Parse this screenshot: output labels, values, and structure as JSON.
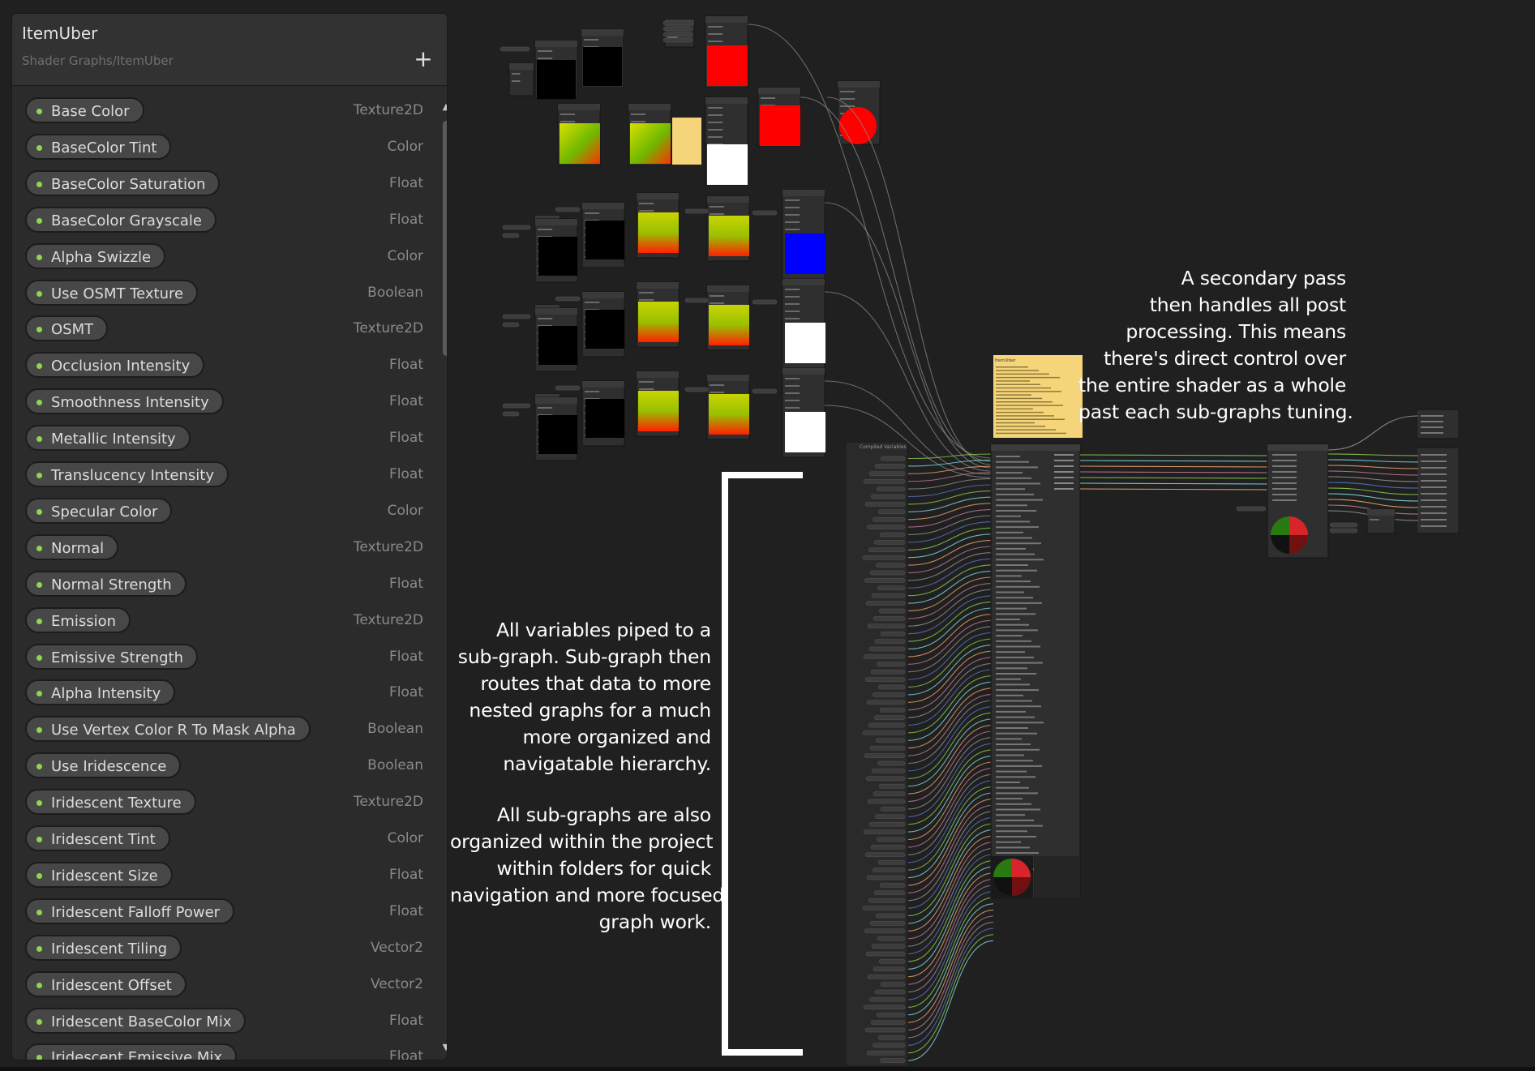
{
  "blackboard": {
    "title": "ItemUber",
    "subtitle": "Shader Graphs/ItemUber",
    "add_label": "+",
    "properties": [
      {
        "name": "Base Color",
        "type": "Texture2D"
      },
      {
        "name": "BaseColor Tint",
        "type": "Color"
      },
      {
        "name": "BaseColor Saturation",
        "type": "Float"
      },
      {
        "name": "BaseColor Grayscale",
        "type": "Float"
      },
      {
        "name": "Alpha Swizzle",
        "type": "Color"
      },
      {
        "name": "Use OSMT Texture",
        "type": "Boolean"
      },
      {
        "name": "OSMT",
        "type": "Texture2D"
      },
      {
        "name": "Occlusion Intensity",
        "type": "Float"
      },
      {
        "name": "Smoothness Intensity",
        "type": "Float"
      },
      {
        "name": "Metallic Intensity",
        "type": "Float"
      },
      {
        "name": "Translucency Intensity",
        "type": "Float"
      },
      {
        "name": "Specular Color",
        "type": "Color"
      },
      {
        "name": "Normal",
        "type": "Texture2D"
      },
      {
        "name": "Normal Strength",
        "type": "Float"
      },
      {
        "name": "Emission",
        "type": "Texture2D"
      },
      {
        "name": "Emissive Strength",
        "type": "Float"
      },
      {
        "name": "Alpha Intensity",
        "type": "Float"
      },
      {
        "name": "Use Vertex Color R To Mask Alpha",
        "type": "Boolean"
      },
      {
        "name": "Use Iridescence",
        "type": "Boolean"
      },
      {
        "name": "Iridescent Texture",
        "type": "Texture2D"
      },
      {
        "name": "Iridescent Tint",
        "type": "Color"
      },
      {
        "name": "Iridescent Size",
        "type": "Float"
      },
      {
        "name": "Iridescent Falloff Power",
        "type": "Float"
      },
      {
        "name": "Iridescent Tiling",
        "type": "Vector2"
      },
      {
        "name": "Iridescent Offset",
        "type": "Vector2"
      },
      {
        "name": "Iridescent BaseColor Mix",
        "type": "Float"
      },
      {
        "name": "Iridescent Emissive Mix",
        "type": "Float"
      }
    ]
  },
  "annotations": {
    "secondary_pass": "A secondary pass\nthen handles all post\nprocessing. This means\nthere's direct control over\nthe entire shader as a whole\npast each sub-graphs tuning.",
    "variables_piped": "All variables piped to a\nsub-graph. Sub-graph then\nroutes that data to more\nnested graphs for a much\nmore organized and\nnavigatable hierarchy.",
    "subgraphs_organized": "All sub-graphs are also\norganized within the project\nwithin folders for quick\nnavigation and more focused\ngraph work."
  },
  "graph": {
    "compiled_variables_title": "Compiled Variables",
    "sticky_note_title": "ItemUber",
    "wire_colors": [
      "#8fd650",
      "#84e4e7",
      "#f8aa6e",
      "#c97f9c",
      "#9a9a9a",
      "#5c7ac9"
    ],
    "preview_colors": [
      "#ff0000",
      "#0000ff",
      "#ffffff",
      "#000000"
    ]
  }
}
